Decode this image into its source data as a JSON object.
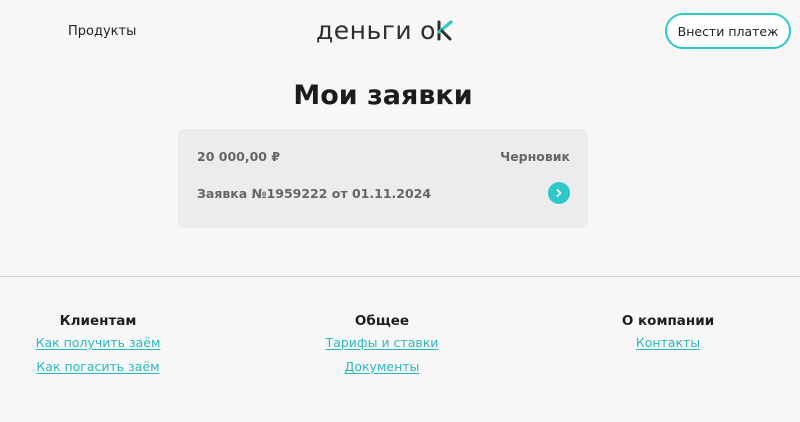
{
  "header": {
    "nav_products": "Продукты",
    "logo_text": "деньги",
    "logo_ok": "o",
    "pay_button": "Внести платеж"
  },
  "main": {
    "title": "Мои заявки",
    "application": {
      "amount": "20 000,00 ₽",
      "status": "Черновик",
      "number": "Заявка №1959222 от 01.11.2024"
    }
  },
  "footer": {
    "columns": [
      {
        "heading": "Клиентам",
        "links": [
          "Как получить заём",
          "Как погасить заём"
        ]
      },
      {
        "heading": "Общее",
        "links": [
          "Тарифы и ставки",
          "Документы"
        ]
      },
      {
        "heading": "О компании",
        "links": [
          "Контакты"
        ]
      }
    ]
  },
  "colors": {
    "accent": "#2ec8c8",
    "link": "#2ab8c0",
    "background": "#f7f7f7",
    "card": "#ececec"
  }
}
